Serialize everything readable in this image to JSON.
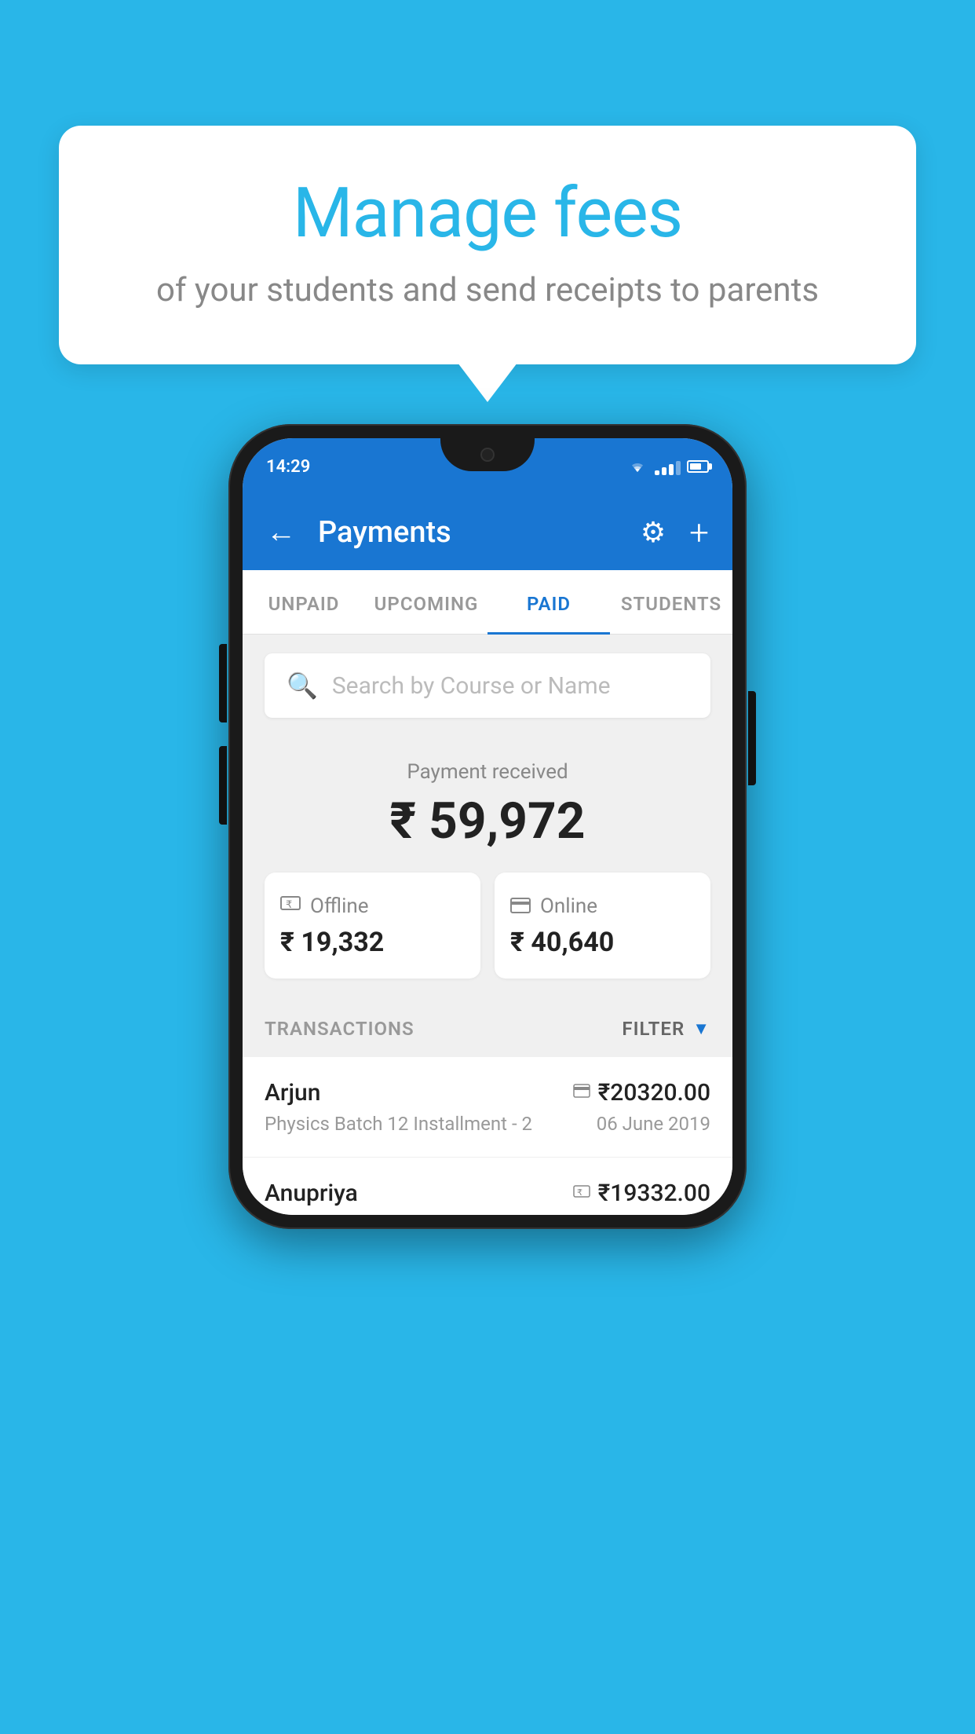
{
  "background_color": "#29b6e8",
  "hero": {
    "title": "Manage fees",
    "subtitle": "of your students and send receipts to parents"
  },
  "status_bar": {
    "time": "14:29",
    "wifi": "▼",
    "signal": [
      4,
      7,
      10,
      13,
      16
    ],
    "battery_pct": 70
  },
  "app_header": {
    "title": "Payments",
    "back_label": "←",
    "gear_label": "⚙",
    "plus_label": "+"
  },
  "tabs": [
    {
      "id": "unpaid",
      "label": "UNPAID",
      "active": false
    },
    {
      "id": "upcoming",
      "label": "UPCOMING",
      "active": false
    },
    {
      "id": "paid",
      "label": "PAID",
      "active": true
    },
    {
      "id": "students",
      "label": "STUDENTS",
      "active": false
    }
  ],
  "search": {
    "placeholder": "Search by Course or Name"
  },
  "payment_summary": {
    "label": "Payment received",
    "amount": "₹ 59,972",
    "offline": {
      "type": "Offline",
      "amount": "₹ 19,332"
    },
    "online": {
      "type": "Online",
      "amount": "₹ 40,640"
    }
  },
  "transactions": {
    "header": "TRANSACTIONS",
    "filter_label": "FILTER",
    "rows": [
      {
        "name": "Arjun",
        "amount": "₹20320.00",
        "payment_type": "online",
        "course": "Physics Batch 12 Installment - 2",
        "date": "06 June 2019"
      },
      {
        "name": "Anupriya",
        "amount": "₹19332.00",
        "payment_type": "offline",
        "course": "",
        "date": ""
      }
    ]
  }
}
